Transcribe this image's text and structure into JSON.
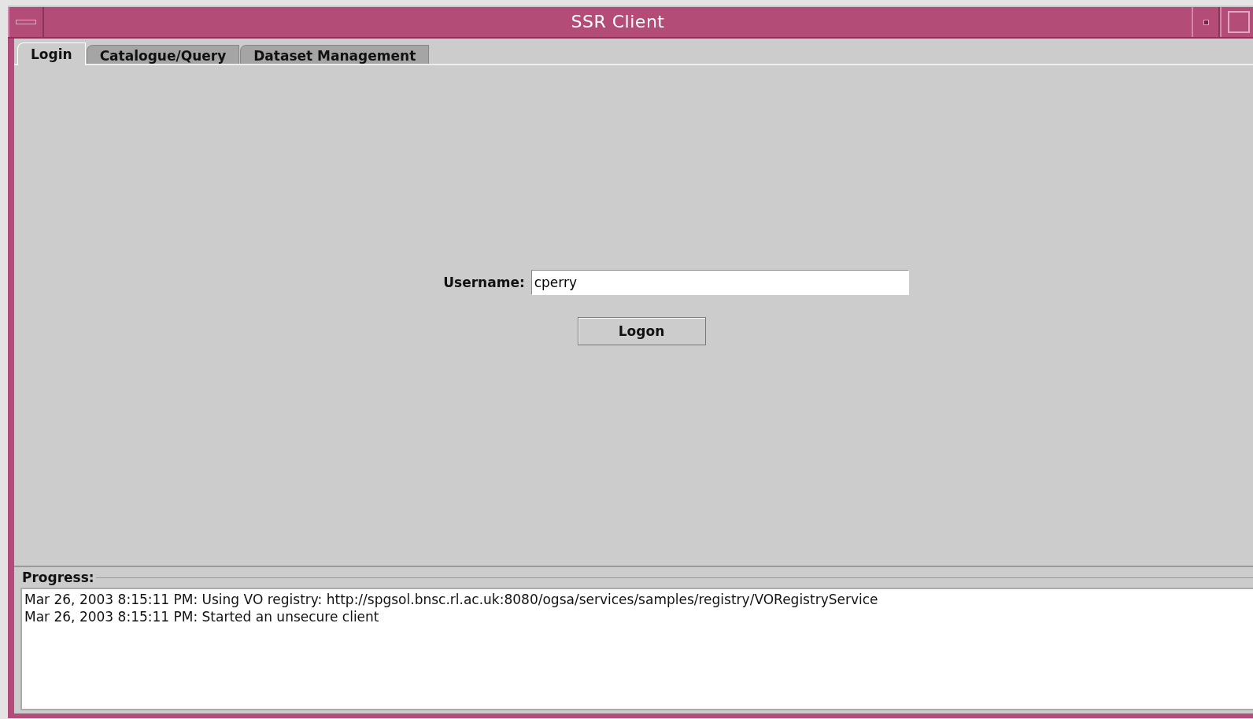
{
  "window": {
    "title": "SSR Client"
  },
  "tabs": [
    {
      "label": "Login",
      "selected": true
    },
    {
      "label": "Catalogue/Query",
      "selected": false
    },
    {
      "label": "Dataset Management",
      "selected": false
    }
  ],
  "login": {
    "username_label": "Username:",
    "username_value": "cperry",
    "logon_button": "Logon"
  },
  "progress": {
    "title": "Progress:",
    "lines": [
      "Mar 26, 2003 8:15:11 PM: Using VO registry: http://spgsol.bnsc.rl.ac.uk:8080/ogsa/services/samples/registry/VORegistryService",
      "Mar 26, 2003 8:15:11 PM: Started an unsecure client"
    ]
  }
}
